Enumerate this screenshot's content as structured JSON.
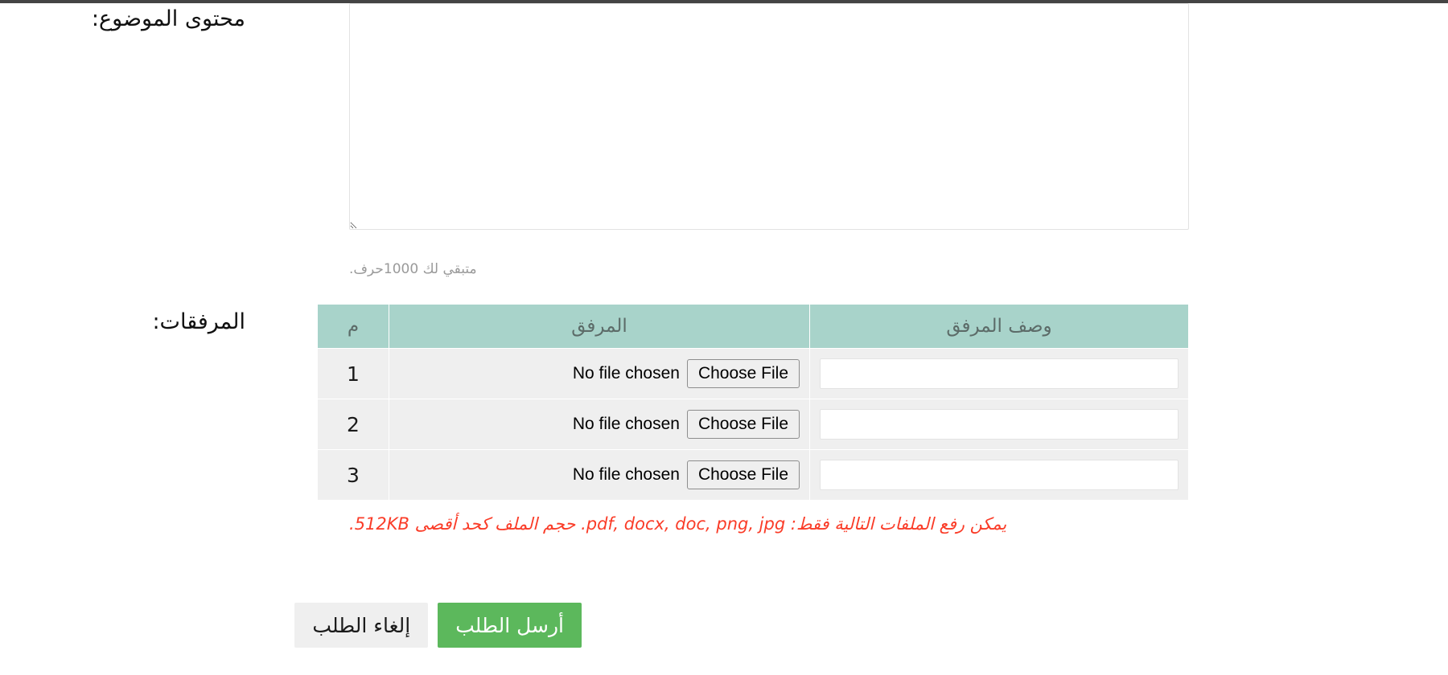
{
  "form": {
    "content_field": {
      "label": "محتوى الموضوع:",
      "value": "",
      "placeholder": "",
      "counter_text": "متبقي لك 1000حرف."
    },
    "attachments": {
      "label": "المرفقات:",
      "columns": {
        "number": "م",
        "file": "المرفق",
        "description": "وصف المرفق"
      },
      "rows": [
        {
          "number": "1",
          "choose_label": "Choose File",
          "file_status": "No file chosen",
          "description_value": "",
          "description_placeholder": ""
        },
        {
          "number": "2",
          "choose_label": "Choose File",
          "file_status": "No file chosen",
          "description_value": "",
          "description_placeholder": ""
        },
        {
          "number": "3",
          "choose_label": "Choose File",
          "file_status": "No file chosen",
          "description_value": "",
          "description_placeholder": ""
        }
      ],
      "hint": "يمكن رفع الملفات التالية فقط: pdf, docx, doc, png, jpg. حجم الملف كحد أقصى 512KB."
    },
    "actions": {
      "submit_label": "أرسل الطلب",
      "cancel_label": "إلغاء الطلب"
    }
  },
  "colors": {
    "table_header": "#a8d3ca",
    "submit_button": "#5cb85c",
    "cancel_button": "#efefef",
    "hint_text": "#fa3c28",
    "row_background": "#efefef"
  }
}
